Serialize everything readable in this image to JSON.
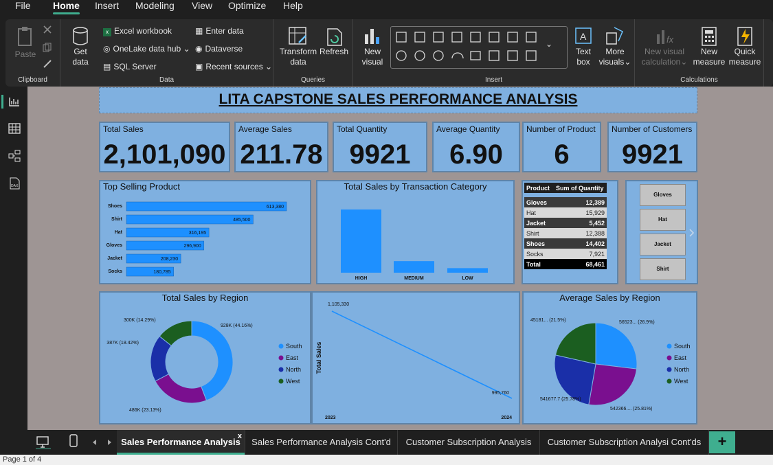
{
  "menu": [
    "File",
    "Home",
    "Insert",
    "Modeling",
    "View",
    "Optimize",
    "Help"
  ],
  "ribbon": {
    "clipboard": {
      "label": "Clipboard",
      "paste": "Paste"
    },
    "data": {
      "label": "Data",
      "get_data": "Get",
      "get_data2": "data",
      "excel": "Excel workbook",
      "onelake": "OneLake data hub",
      "sql": "SQL Server",
      "enter": "Enter data",
      "dataverse": "Dataverse",
      "recent": "Recent sources"
    },
    "queries": {
      "label": "Queries",
      "transform": "Transform",
      "transform2": "data",
      "refresh": "Refresh"
    },
    "insert": {
      "label": "Insert",
      "new_visual": "New",
      "new_visual2": "visual",
      "text_box": "Text",
      "text_box2": "box",
      "more_visuals": "More",
      "more_visuals2": "visuals"
    },
    "calculations": {
      "label": "Calculations",
      "new_visual_calc": "New visual",
      "new_visual_calc2": "calculation",
      "new_measure": "New",
      "new_measure2": "measure",
      "quick_measure": "Quick",
      "quick_measure2": "measure"
    }
  },
  "report": {
    "title": "LITA CAPSTONE SALES PERFORMANCE ANALYSIS",
    "kpis": [
      {
        "label": "Total Sales",
        "value": "2,101,090"
      },
      {
        "label": "Average Sales",
        "value": "211.78"
      },
      {
        "label": "Total Quantity",
        "value": "9921"
      },
      {
        "label": "Average Quantity",
        "value": "6.90"
      },
      {
        "label": "Number of Product",
        "value": "6"
      },
      {
        "label": "Number of Customers",
        "value": "9921"
      }
    ],
    "top_selling_title": "Top Selling Product",
    "txn_title": "Total Sales by Transaction Category",
    "region_title": "Total Sales by Region",
    "avg_region_title": "Average Sales by Region",
    "line_ylabel": "Total Sales",
    "matrix": {
      "headers": [
        "Product",
        "Sum of Quantity"
      ],
      "rows": [
        {
          "product": "Gloves",
          "qty": "12,389"
        },
        {
          "product": "Hat",
          "qty": "15,929"
        },
        {
          "product": "Jacket",
          "qty": "5,452"
        },
        {
          "product": "Shirt",
          "qty": "12,388"
        },
        {
          "product": "Shoes",
          "qty": "14,402"
        },
        {
          "product": "Socks",
          "qty": "7,921"
        }
      ],
      "total_label": "Total",
      "total_value": "68,461"
    },
    "slicer": [
      "Gloves",
      "Hat",
      "Jacket",
      "Shirt"
    ],
    "colors": {
      "bar": "#1e90ff",
      "south": "#1e90ff",
      "east": "#7a0f8f",
      "north": "#1a2fa8",
      "west": "#1b5e20"
    }
  },
  "chart_data": [
    {
      "type": "bar",
      "title": "Top Selling Product",
      "categories": [
        "Shoes",
        "Shirt",
        "Hat",
        "Gloves",
        "Jacket",
        "Socks"
      ],
      "values": [
        613380,
        485500,
        316195,
        296900,
        208230,
        180785
      ],
      "labels": [
        "613,380",
        "485,500",
        "316,195",
        "296,900",
        "208,230",
        "180,785"
      ]
    },
    {
      "type": "bar",
      "title": "Total Sales by Transaction Category",
      "categories": [
        "HIGH",
        "MEDIUM",
        "LOW"
      ],
      "values": [
        1530000,
        280000,
        110000
      ]
    },
    {
      "type": "pie",
      "title": "Total Sales by Region",
      "labels": [
        "South",
        "East",
        "North",
        "West"
      ],
      "values": [
        928,
        486,
        387,
        300
      ],
      "slice_labels": [
        "928K (44.16%)",
        "486K (23.13%)",
        "387K (18.42%)",
        "300K (14.29%)"
      ]
    },
    {
      "type": "line",
      "ylabel": "Total Sales",
      "x": [
        "2023",
        "2024"
      ],
      "values": [
        1105330,
        995760
      ],
      "point_labels": [
        "1,105,330",
        "995,760"
      ]
    },
    {
      "type": "pie",
      "title": "Average Sales by Region",
      "labels": [
        "South",
        "East",
        "North",
        "West"
      ],
      "values": [
        26.9,
        25.81,
        25.78,
        21.5
      ],
      "slice_labels": [
        "56523... (26.9%)",
        "542366.... (25.81%)",
        "541677.7 (25.78%)",
        "45181... (21.5%)"
      ]
    }
  ],
  "tabs": [
    "Sales Performance Analysis",
    "Sales Performance Analysis Cont'd",
    "Customer Subscription Analysis",
    "Customer Subscription Analysi Cont'ds"
  ],
  "tab_close": "x",
  "add_page": "+",
  "status": "Page 1 of 4"
}
